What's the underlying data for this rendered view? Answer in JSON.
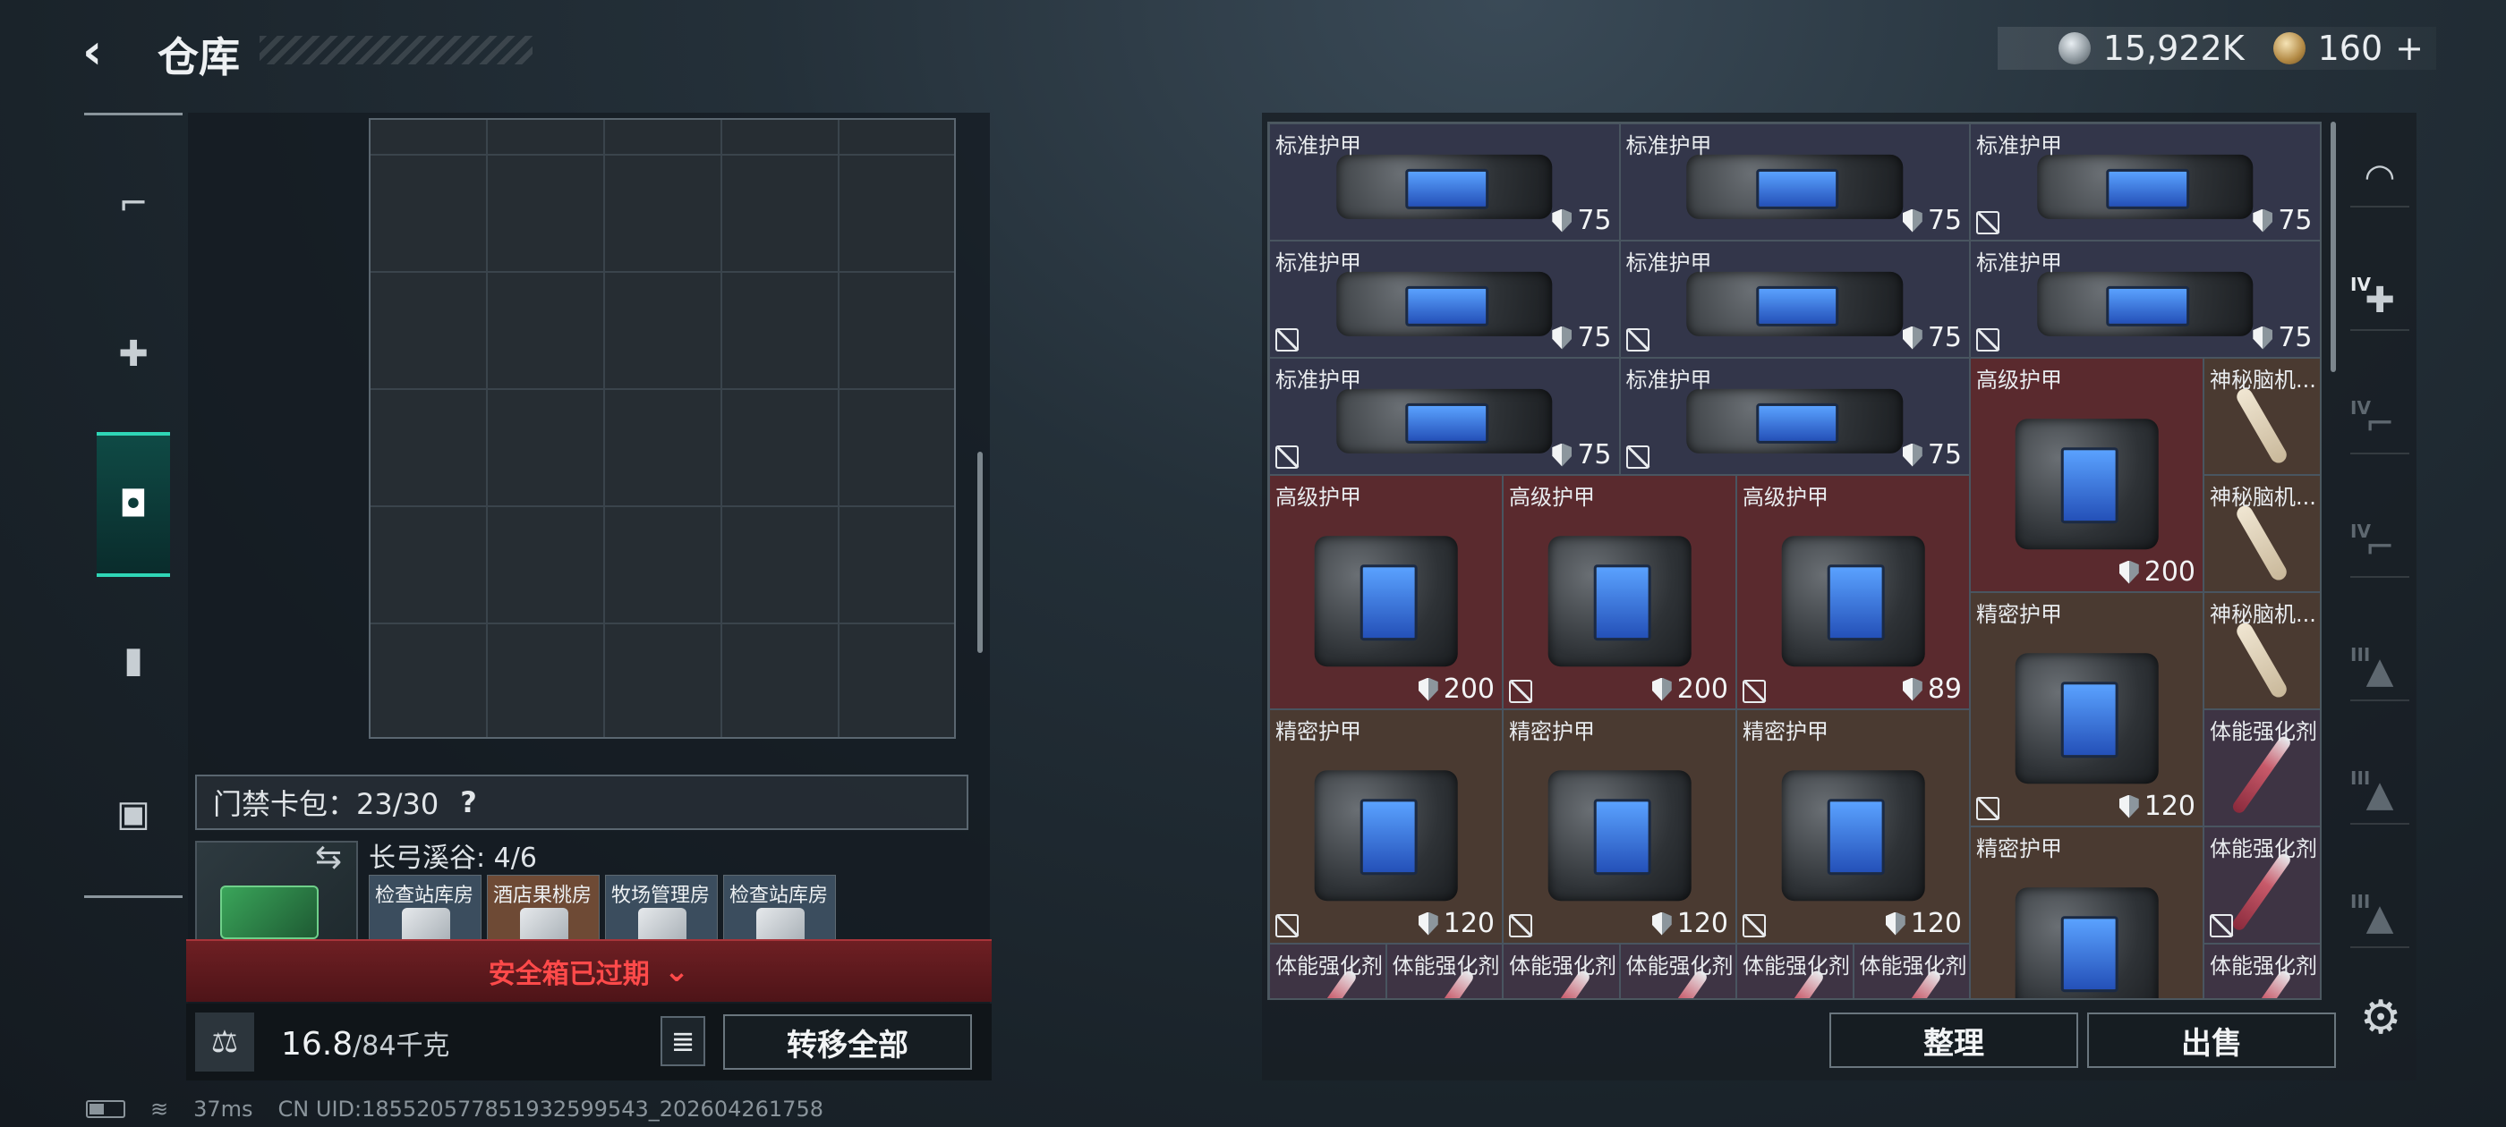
{
  "header": {
    "back_icon": "chevron-left-icon",
    "title": "仓库"
  },
  "currency": {
    "silver_amount": "15,922K",
    "gold_amount": "160",
    "add_label": "+"
  },
  "left_rail": {
    "icons": [
      "pistol-icon",
      "medkit-icon",
      "backpack-icon",
      "vest-icon",
      "briefcase-icon"
    ],
    "active_index": 2
  },
  "keycard": {
    "label": "门禁卡包：23/30",
    "help": "?"
  },
  "region": {
    "label": "长弓溪谷: 4/6"
  },
  "room_cards": [
    "检查站库房",
    "酒店果桃房",
    "牧场管理房",
    "检查站库房"
  ],
  "safe_box": {
    "expired_label": "安全箱已过期",
    "chevron": "⌄"
  },
  "weight": {
    "current": "16.8",
    "max": "/84千克"
  },
  "buttons": {
    "transfer_all": "转移全部",
    "organize": "整理",
    "sell": "出售"
  },
  "inventory": [
    {
      "name": "标准护甲",
      "value": "75",
      "type": "std",
      "col": 0,
      "row": 0,
      "w": 3,
      "h": 1,
      "nosell": false
    },
    {
      "name": "标准护甲",
      "value": "75",
      "type": "std",
      "col": 3,
      "row": 0,
      "w": 3,
      "h": 1,
      "nosell": false
    },
    {
      "name": "标准护甲",
      "value": "75",
      "type": "std",
      "col": 6,
      "row": 0,
      "w": 3,
      "h": 1,
      "nosell": true
    },
    {
      "name": "标准护甲",
      "value": "75",
      "type": "std",
      "col": 0,
      "row": 1,
      "w": 3,
      "h": 1,
      "nosell": true
    },
    {
      "name": "标准护甲",
      "value": "75",
      "type": "std",
      "col": 3,
      "row": 1,
      "w": 3,
      "h": 1,
      "nosell": true
    },
    {
      "name": "标准护甲",
      "value": "75",
      "type": "std",
      "col": 6,
      "row": 1,
      "w": 3,
      "h": 1,
      "nosell": true
    },
    {
      "name": "标准护甲",
      "value": "75",
      "type": "std",
      "col": 0,
      "row": 2,
      "w": 3,
      "h": 1,
      "nosell": true
    },
    {
      "name": "标准护甲",
      "value": "75",
      "type": "std",
      "col": 3,
      "row": 2,
      "w": 3,
      "h": 1,
      "nosell": true
    },
    {
      "name": "高级护甲",
      "value": "200",
      "type": "adv",
      "col": 6,
      "row": 2,
      "w": 2,
      "h": 2,
      "nosell": false
    },
    {
      "name": "神秘脑机...",
      "value": "",
      "type": "prec",
      "col": 8,
      "row": 2,
      "w": 1,
      "h": 1,
      "nosell": false,
      "art": "wire"
    },
    {
      "name": "高级护甲",
      "value": "200",
      "type": "adv",
      "col": 0,
      "row": 3,
      "w": 2,
      "h": 2,
      "nosell": false
    },
    {
      "name": "高级护甲",
      "value": "200",
      "type": "adv",
      "col": 2,
      "row": 3,
      "w": 2,
      "h": 2,
      "nosell": true
    },
    {
      "name": "高级护甲",
      "value": "89",
      "type": "adv",
      "col": 4,
      "row": 3,
      "w": 2,
      "h": 2,
      "nosell": true
    },
    {
      "name": "神秘脑机...",
      "value": "",
      "type": "prec",
      "col": 8,
      "row": 3,
      "w": 1,
      "h": 1,
      "nosell": false,
      "art": "wire"
    },
    {
      "name": "精密护甲",
      "value": "120",
      "type": "prec",
      "col": 6,
      "row": 4,
      "w": 2,
      "h": 2,
      "nosell": true
    },
    {
      "name": "神秘脑机...",
      "value": "",
      "type": "prec",
      "col": 8,
      "row": 4,
      "w": 1,
      "h": 1,
      "nosell": false,
      "art": "wire"
    },
    {
      "name": "精密护甲",
      "value": "120",
      "type": "prec",
      "col": 0,
      "row": 5,
      "w": 2,
      "h": 2,
      "nosell": true
    },
    {
      "name": "精密护甲",
      "value": "120",
      "type": "prec",
      "col": 2,
      "row": 5,
      "w": 2,
      "h": 2,
      "nosell": true
    },
    {
      "name": "精密护甲",
      "value": "120",
      "type": "prec",
      "col": 4,
      "row": 5,
      "w": 2,
      "h": 2,
      "nosell": true
    },
    {
      "name": "体能强化剂",
      "value": "",
      "type": "cons",
      "col": 8,
      "row": 5,
      "w": 1,
      "h": 1,
      "nosell": false,
      "art": "tube"
    },
    {
      "name": "精密护甲",
      "value": "",
      "type": "prec",
      "col": 6,
      "row": 6,
      "w": 2,
      "h": 2,
      "nosell": false
    },
    {
      "name": "体能强化剂",
      "value": "",
      "type": "cons",
      "col": 8,
      "row": 6,
      "w": 1,
      "h": 1,
      "nosell": true,
      "art": "tube"
    },
    {
      "name": "体能强化剂",
      "value": "",
      "type": "cons",
      "col": 0,
      "row": 7,
      "w": 1,
      "h": 1,
      "nosell": false,
      "art": "tube"
    },
    {
      "name": "体能强化剂",
      "value": "",
      "type": "cons",
      "col": 1,
      "row": 7,
      "w": 1,
      "h": 1,
      "nosell": false,
      "art": "tube"
    },
    {
      "name": "体能强化剂",
      "value": "",
      "type": "cons",
      "col": 2,
      "row": 7,
      "w": 1,
      "h": 1,
      "nosell": false,
      "art": "tube"
    },
    {
      "name": "体能强化剂",
      "value": "",
      "type": "cons",
      "col": 3,
      "row": 7,
      "w": 1,
      "h": 1,
      "nosell": false,
      "art": "tube"
    },
    {
      "name": "体能强化剂",
      "value": "",
      "type": "cons",
      "col": 4,
      "row": 7,
      "w": 1,
      "h": 1,
      "nosell": false,
      "art": "tube"
    },
    {
      "name": "体能强化剂",
      "value": "",
      "type": "cons",
      "col": 5,
      "row": 7,
      "w": 1,
      "h": 1,
      "nosell": false,
      "art": "tube"
    },
    {
      "name": "体能强化剂",
      "value": "",
      "type": "cons",
      "col": 8,
      "row": 7,
      "w": 1,
      "h": 1,
      "nosell": false,
      "art": "tube"
    }
  ],
  "right_rail": [
    {
      "icon": "helmet-icon",
      "tier": "",
      "dim": false
    },
    {
      "icon": "medkit-plus-icon",
      "tier": "IV",
      "dim": false
    },
    {
      "icon": "rifle-icon",
      "tier": "IV",
      "dim": true
    },
    {
      "icon": "rifle-icon",
      "tier": "IV",
      "dim": true
    },
    {
      "icon": "armor-icon",
      "tier": "III",
      "dim": true
    },
    {
      "icon": "armor-icon",
      "tier": "III",
      "dim": true
    },
    {
      "icon": "armor-icon",
      "tier": "III",
      "dim": true
    }
  ],
  "settings_icon": "gear-icon",
  "status_bar": {
    "latency": "37ms",
    "uid": "CN UID:185520577851932599543_202604261758"
  }
}
